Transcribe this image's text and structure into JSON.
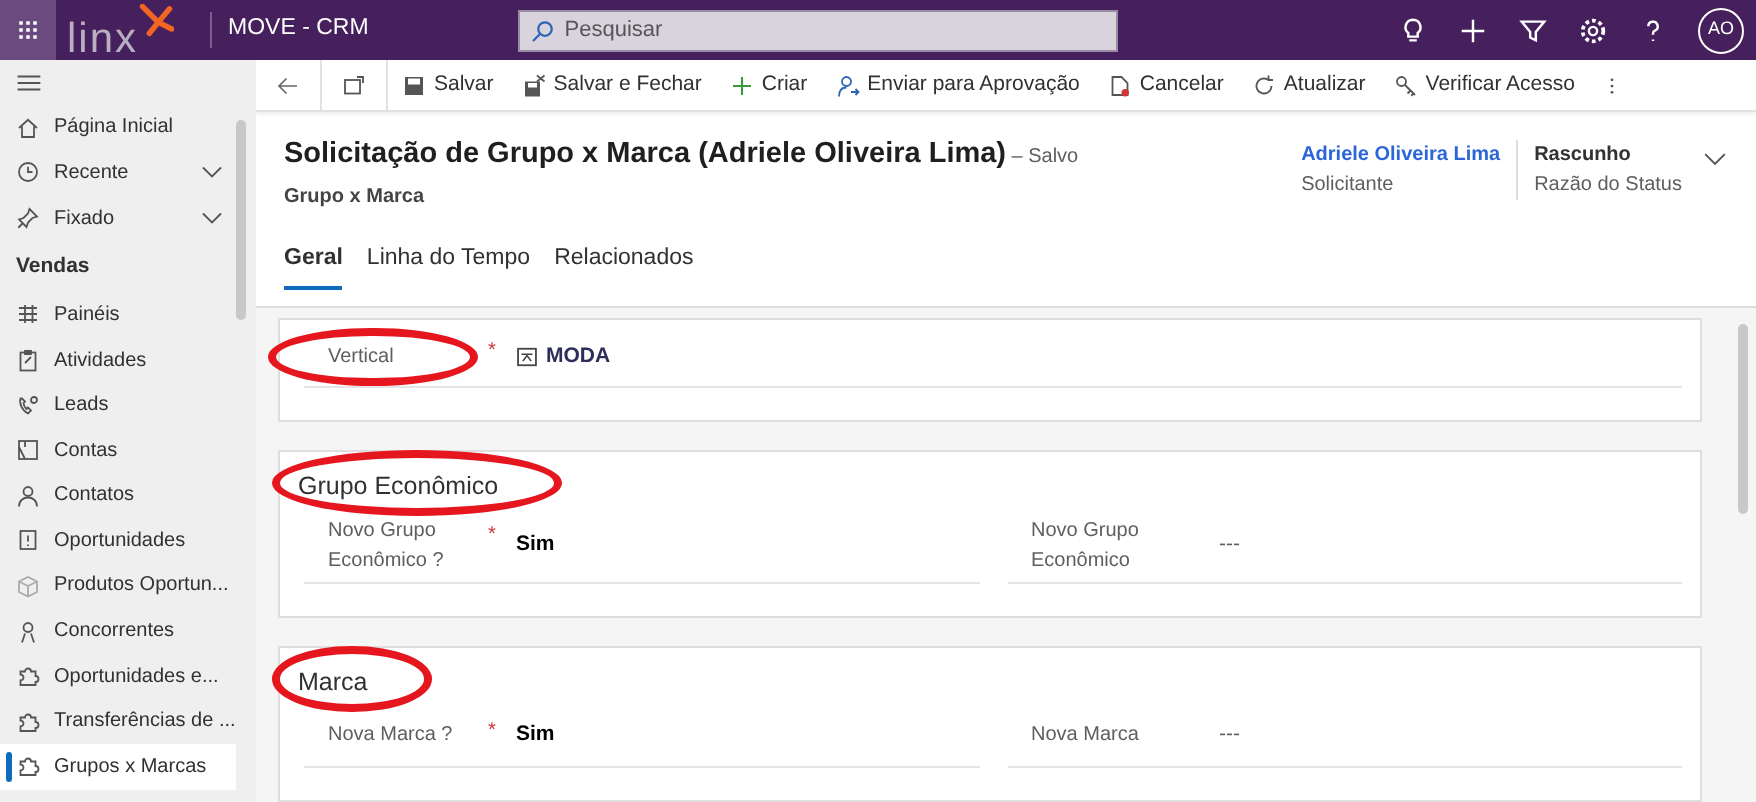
{
  "app": {
    "logo": "linx",
    "title": "MOVE - CRM",
    "search": {
      "placeholder": "Pesquisar"
    },
    "user_initials": "AO"
  },
  "sidebar": {
    "top_items": [
      {
        "label": "Página Inicial",
        "expandable": false
      },
      {
        "label": "Recente",
        "expandable": true
      },
      {
        "label": "Fixado",
        "expandable": true
      }
    ],
    "section_title": "Vendas",
    "items": [
      {
        "label": "Painéis",
        "selected": false
      },
      {
        "label": "Atividades",
        "selected": false
      },
      {
        "label": "Leads",
        "selected": false
      },
      {
        "label": "Contas",
        "selected": false
      },
      {
        "label": "Contatos",
        "selected": false
      },
      {
        "label": "Oportunidades",
        "selected": false
      },
      {
        "label": "Produtos Oportun...",
        "selected": false
      },
      {
        "label": "Concorrentes",
        "selected": false
      },
      {
        "label": "Oportunidades e...",
        "selected": false
      },
      {
        "label": "Transferências de ...",
        "selected": false
      },
      {
        "label": "Grupos x Marcas",
        "selected": true
      }
    ]
  },
  "commands": [
    "Salvar",
    "Salvar e Fechar",
    "Criar",
    "Enviar para Aprovação",
    "Cancelar",
    "Atualizar",
    "Verificar Acesso"
  ],
  "record": {
    "title": "Solicitação de Grupo x Marca (Adriele Oliveira Lima)",
    "save_state": "– Salvo",
    "entity": "Grupo x Marca",
    "owner": {
      "value": "Adriele Oliveira Lima",
      "label": "Solicitante"
    },
    "status": {
      "value": "Rascunho",
      "label": "Razão do Status"
    }
  },
  "tabs": [
    {
      "label": "Geral",
      "selected": true
    },
    {
      "label": "Linha do Tempo",
      "selected": false
    },
    {
      "label": "Relacionados",
      "selected": false
    }
  ],
  "sections": [
    {
      "fields": [
        {
          "label": "Vertical",
          "required_mark": "*",
          "kind": "lookup",
          "value": "MODA",
          "circled": true
        }
      ]
    },
    {
      "title": "Grupo Econômico",
      "circled": true,
      "fields": [
        {
          "label": "Novo Grupo Econômico ?",
          "required_mark": "*",
          "kind": "text",
          "value": "Sim",
          "circled": false
        },
        {
          "label": "Novo Grupo Econômico",
          "kind": "text",
          "value": "---",
          "circled": false
        }
      ]
    },
    {
      "title": "Marca",
      "circled": true,
      "fields": [
        {
          "label": "Nova Marca ?",
          "required_mark": "*",
          "kind": "text",
          "value": "Sim",
          "circled": false
        },
        {
          "label": "Nova Marca",
          "kind": "text",
          "value": "---",
          "circled": false
        }
      ]
    }
  ]
}
